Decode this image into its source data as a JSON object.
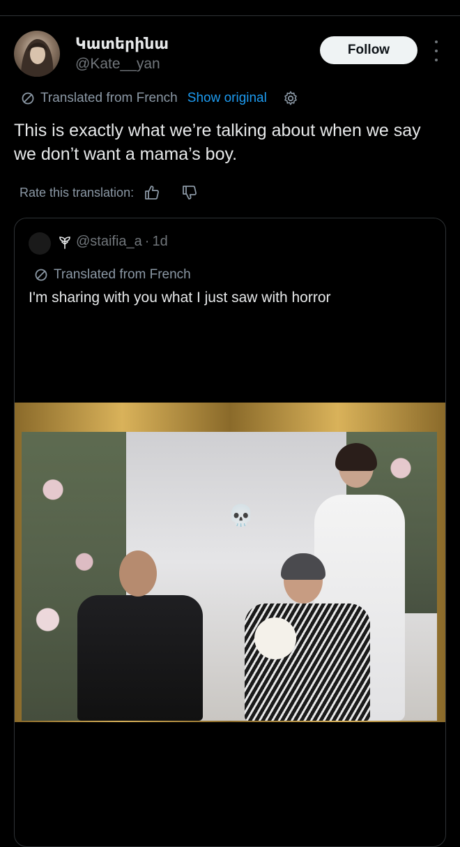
{
  "author": {
    "display_name": "Կատերինա",
    "handle": "@Kate__yan"
  },
  "follow_label": "Follow",
  "translation": {
    "label": "Translated from French",
    "show_original": "Show original"
  },
  "tweet_text": "This is exactly what we’re talking about when we say we don’t want a mama’s boy.",
  "rate_label": "Rate this translation:",
  "quoted": {
    "handle": "@staifia_a",
    "separator": "·",
    "time": "1d",
    "translation_label": "Translated from French",
    "text": "I'm sharing with you what I just saw with horror",
    "media_emoji": "💀"
  },
  "colors": {
    "background": "#000000",
    "text": "#e7e9ea",
    "muted": "#71767b",
    "link": "#1d9bf0",
    "follow_bg": "#eff3f4",
    "border": "#2f3336"
  },
  "icons": [
    "more-icon",
    "translate-icon",
    "gear-icon",
    "thumbs-up-icon",
    "thumbs-down-icon",
    "sprout-icon",
    "skull-icon"
  ]
}
